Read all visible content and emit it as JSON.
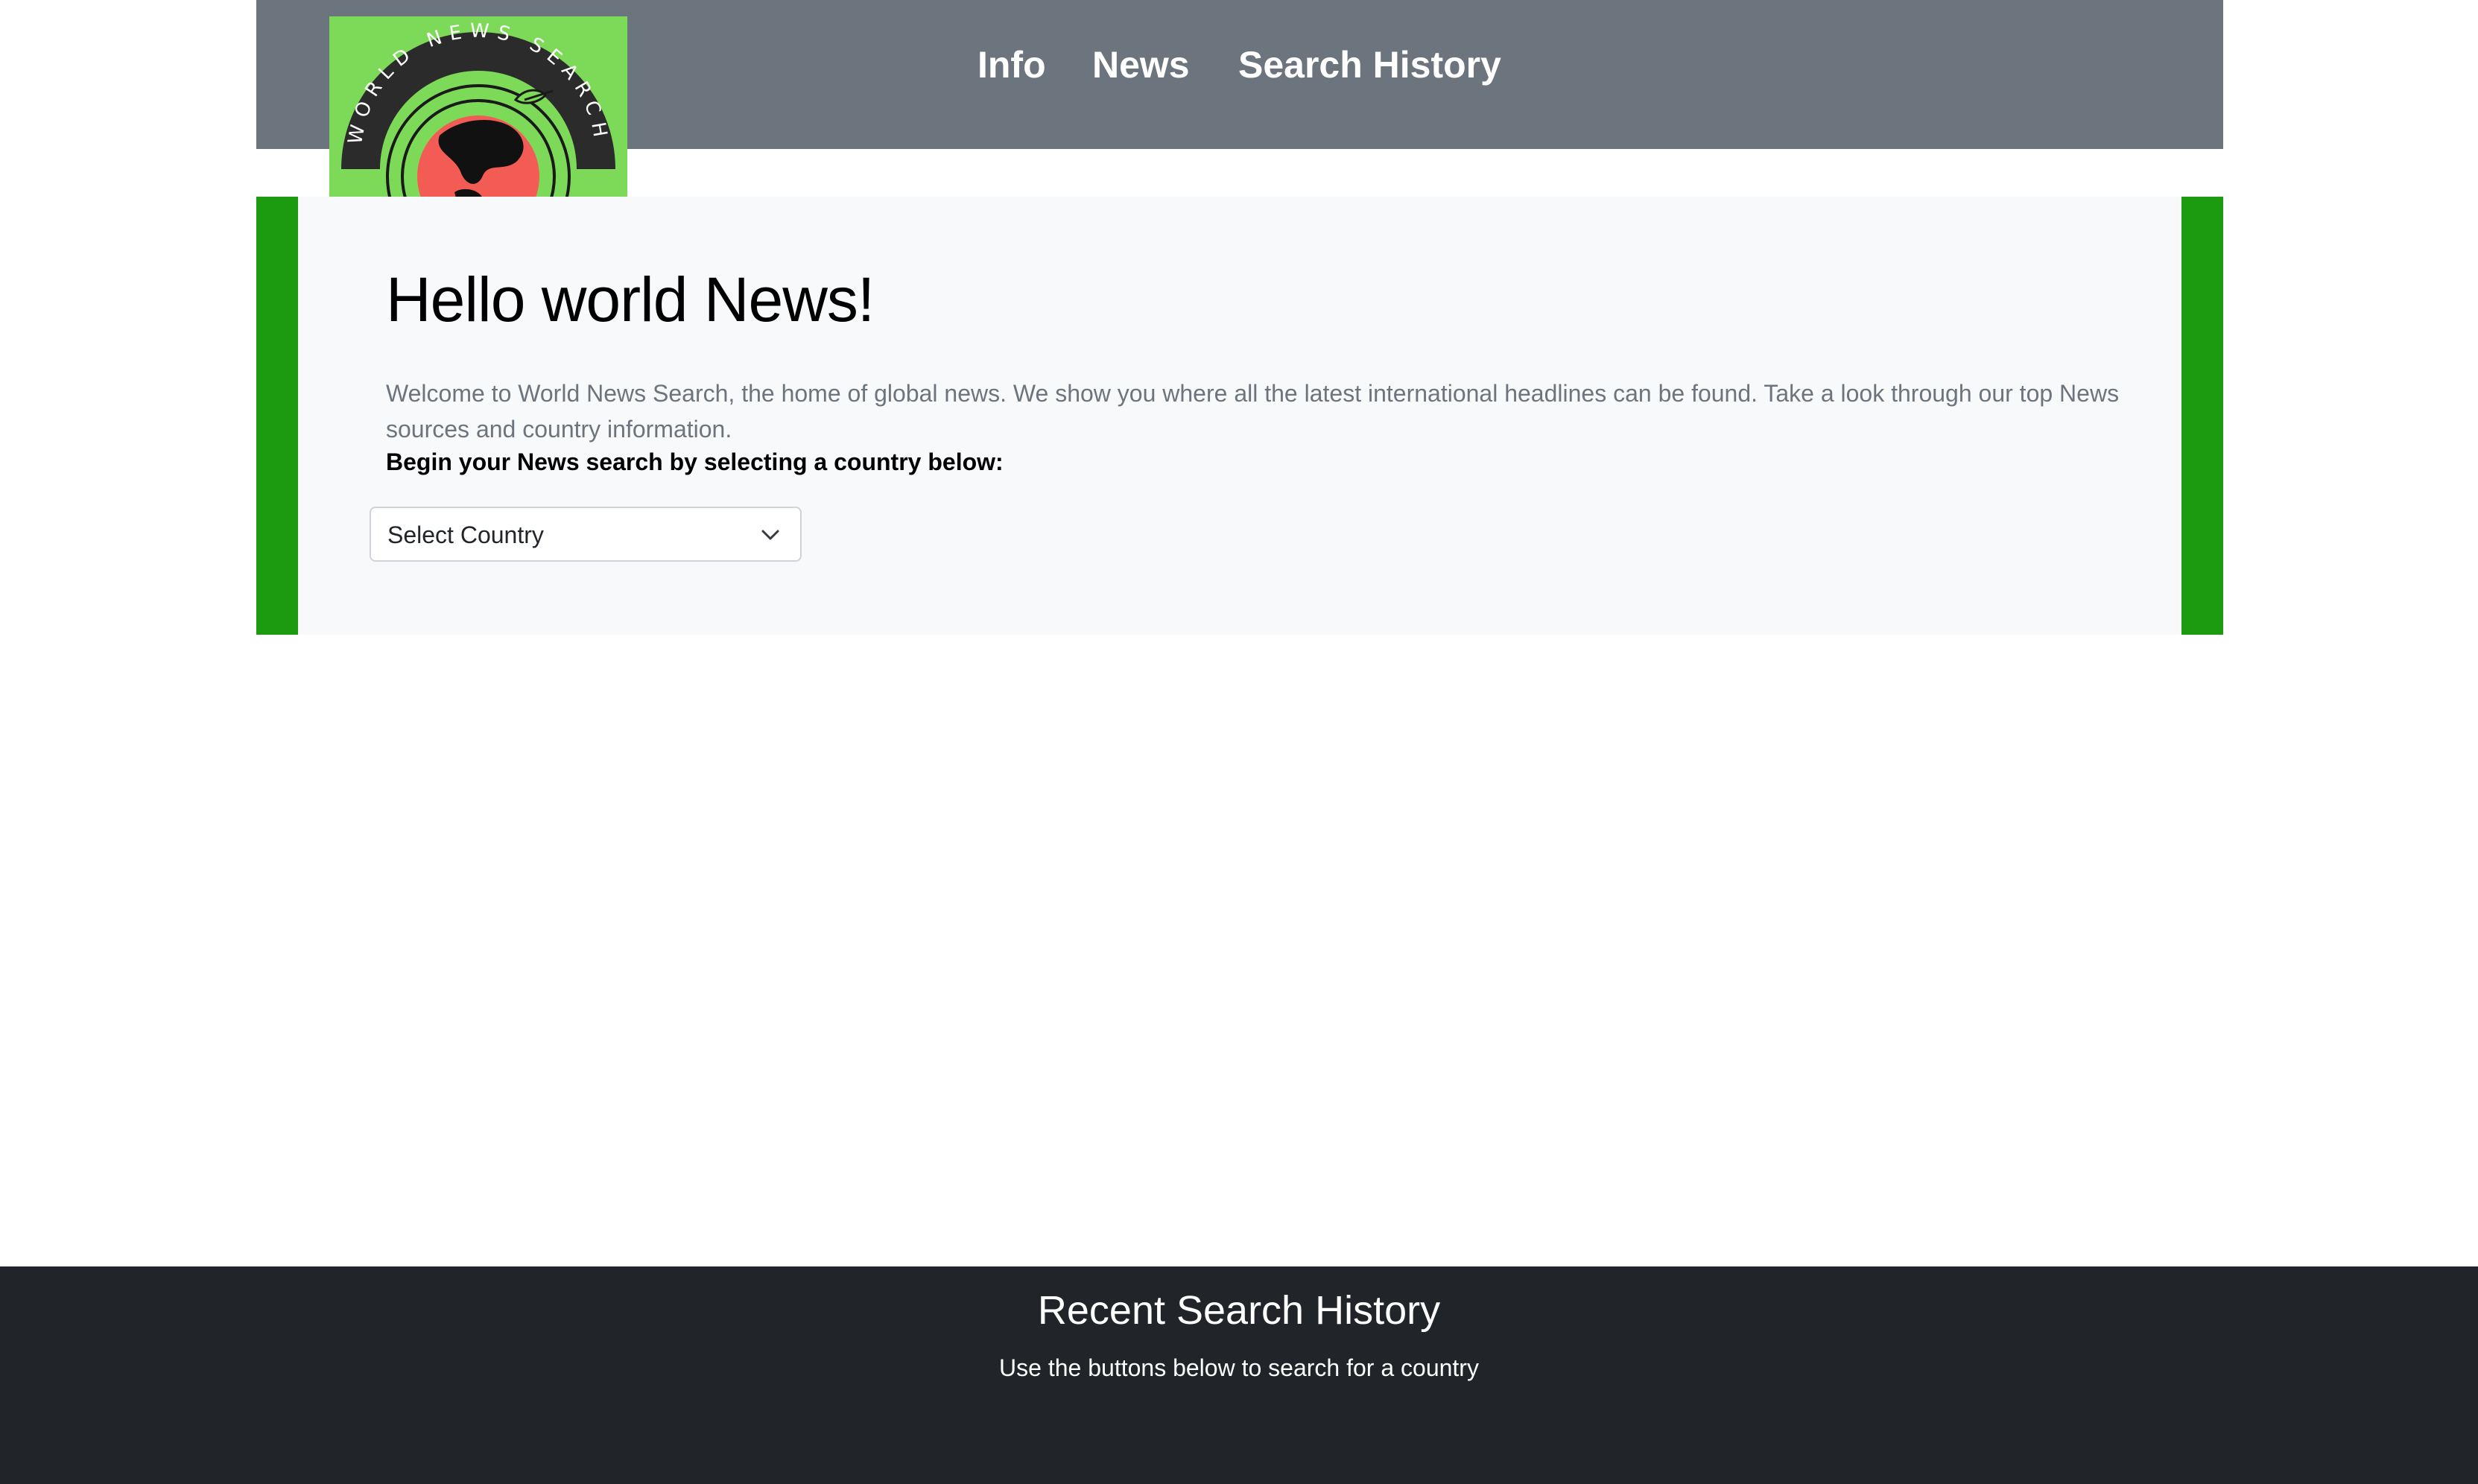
{
  "logo": {
    "text": "WORLD NEWS SEARCH",
    "colors": {
      "background": "#7dda58",
      "band": "#2b2b2b",
      "globe": "#f25c54"
    }
  },
  "nav": {
    "items": [
      {
        "label": "Info"
      },
      {
        "label": "News"
      },
      {
        "label": "Search History"
      }
    ]
  },
  "hero": {
    "title": "Hello world News!",
    "description": "Welcome to World News Search, the home of global news. We show you where all the latest international headlines can be found. Take a look through our top News sources and country information.",
    "prompt": "Begin your News search by selecting a country below:",
    "select": {
      "value": "Select Country",
      "icon": "chevron-down-icon"
    }
  },
  "footer": {
    "title": "Recent Search History",
    "subtitle": "Use the buttons below to search for a country"
  },
  "colors": {
    "header_bg": "#6c757d",
    "accent_green": "#1c9a10",
    "hero_bg": "#f8f9fa",
    "footer_bg": "#212529"
  }
}
